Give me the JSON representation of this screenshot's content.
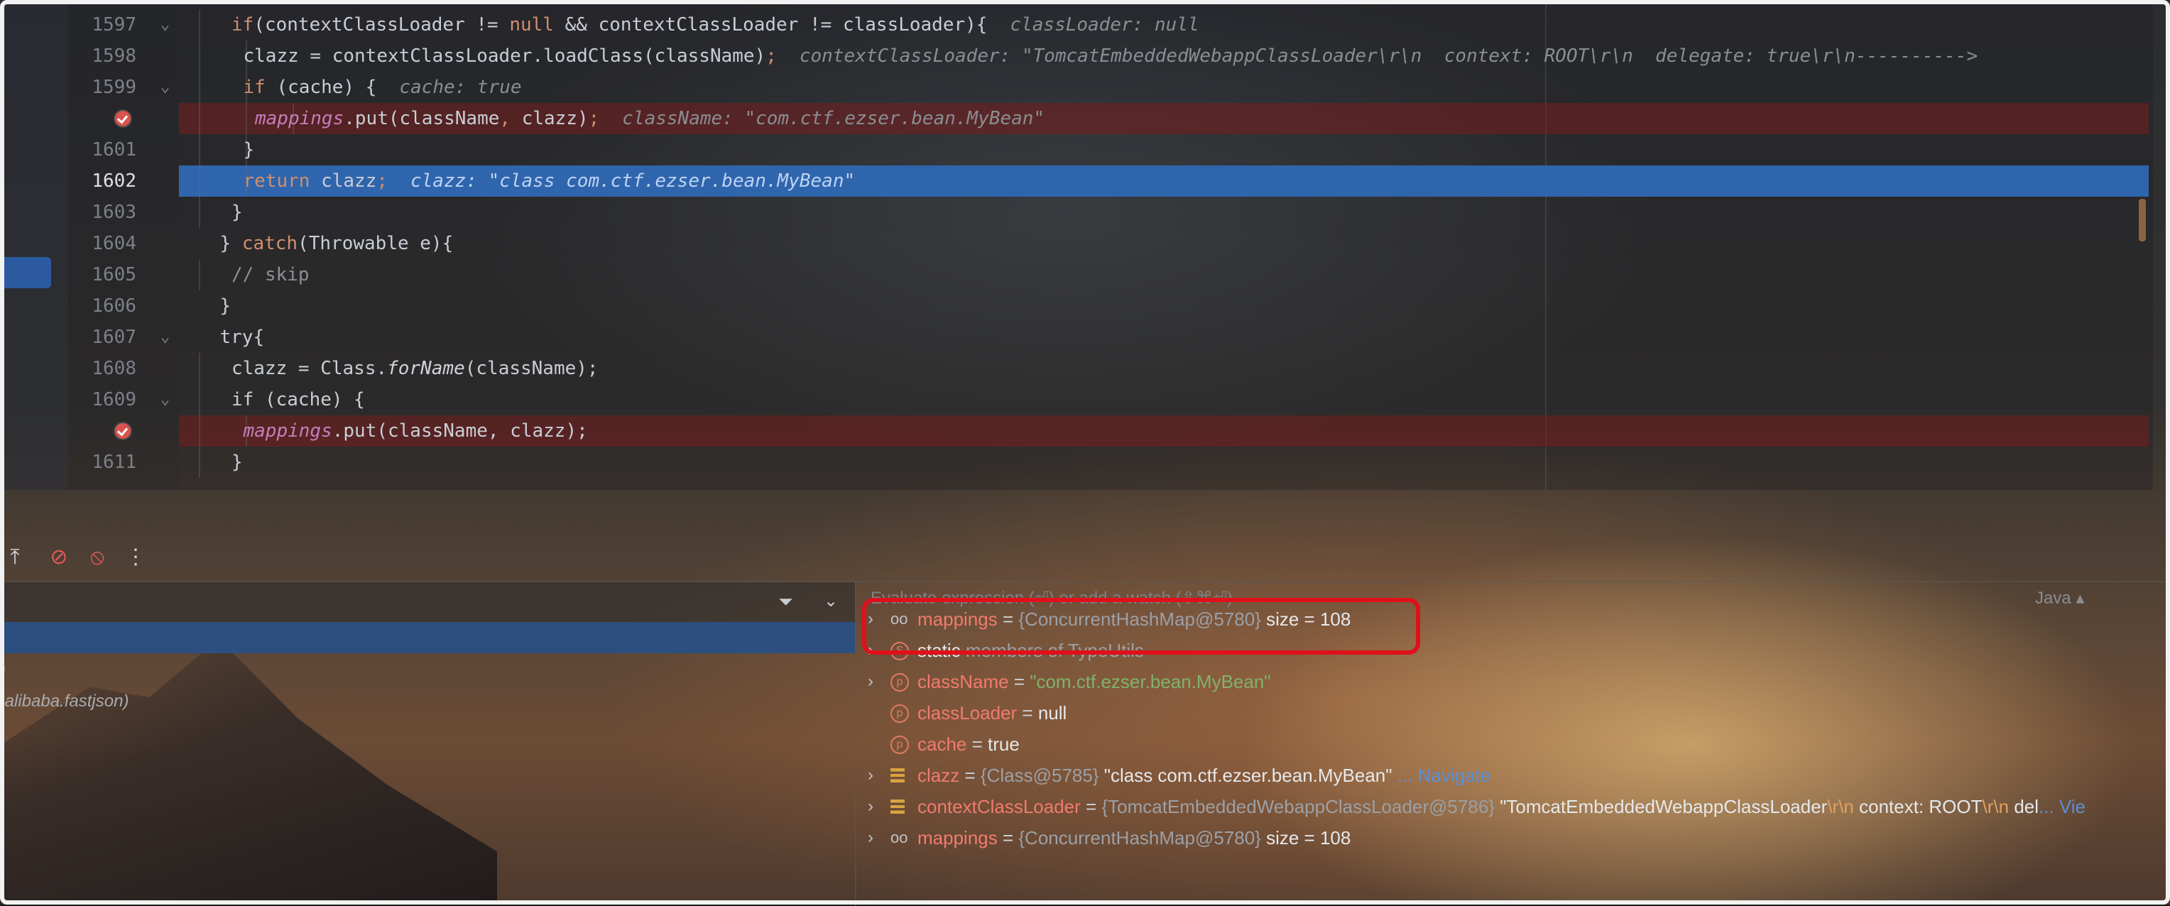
{
  "editor": {
    "lines": [
      {
        "num": "1597",
        "fold": "⌄",
        "code": [
          [
            "kw",
            "if"
          ],
          [
            "t",
            "(contextClassLoader != "
          ],
          [
            "kw",
            "null"
          ],
          [
            "t",
            " && contextClassLoader != classLoader){"
          ]
        ],
        "hint": "classLoader: null",
        "indent": 4
      },
      {
        "num": "1598",
        "code": [
          [
            "t",
            "clazz = contextClassLoader.loadClass(className)"
          ],
          [
            "kw",
            ";"
          ]
        ],
        "hint": "contextClassLoader: \"TomcatEmbeddedWebappClassLoader\\r\\n  context: ROOT\\r\\n  delegate: true\\r\\n---------->",
        "indent": 5
      },
      {
        "num": "1599",
        "fold": "⌄",
        "code": [
          [
            "kw",
            "if"
          ],
          [
            "t",
            " (cache) {"
          ]
        ],
        "hint": "cache: true",
        "indent": 5
      },
      {
        "num": "",
        "bp": true,
        "code": [
          [
            "fld",
            "mappings"
          ],
          [
            "t",
            ".put(className"
          ],
          [
            "kw",
            ","
          ],
          [
            "t",
            " clazz)"
          ],
          [
            "kw",
            ";"
          ]
        ],
        "hint": "className: \"com.ctf.ezser.bean.MyBean\"",
        "indent": 6
      },
      {
        "num": "1601",
        "code": [
          [
            "t",
            "}"
          ]
        ],
        "indent": 5
      },
      {
        "num": "1602",
        "cur": true,
        "code": [
          [
            "kw",
            "return"
          ],
          [
            "t",
            " clazz"
          ],
          [
            "kw",
            ";"
          ]
        ],
        "hint": "clazz: \"class com.ctf.ezser.bean.MyBean\"",
        "indent": 5
      },
      {
        "num": "1603",
        "code": [
          [
            "t",
            "}"
          ]
        ],
        "indent": 4
      },
      {
        "num": "1604",
        "code": [
          [
            "t",
            "} "
          ],
          [
            "kw",
            "catch"
          ],
          [
            "t",
            "(Throwable e){"
          ]
        ],
        "indent": 3
      },
      {
        "num": "1605",
        "code": [
          [
            "cmt",
            "// skip"
          ]
        ],
        "indent": 4
      },
      {
        "num": "1606",
        "code": [
          [
            "t",
            "}"
          ]
        ],
        "indent": 3
      },
      {
        "num": "1607",
        "fold": "⌄",
        "code": [
          [
            "t",
            "try{"
          ]
        ],
        "indent": 3
      },
      {
        "num": "1608",
        "code": [
          [
            "t",
            "clazz = Class."
          ],
          [
            "ital",
            "forName"
          ],
          [
            "t",
            "(className);"
          ]
        ],
        "indent": 4
      },
      {
        "num": "1609",
        "fold": "⌄",
        "code": [
          [
            "t",
            "if (cache) {"
          ]
        ],
        "indent": 4
      },
      {
        "num": "",
        "bp": true,
        "code": [
          [
            "fld",
            "mappings"
          ],
          [
            "t",
            ".put(className, clazz);"
          ]
        ],
        "indent": 5
      },
      {
        "num": "1611",
        "code": [
          [
            "t",
            "}"
          ]
        ],
        "indent": 4
      }
    ]
  },
  "toolbar": {
    "icons": [
      "export-icon",
      "mute-breakpoints-icon",
      "clear-breakpoints-icon",
      "more-icon"
    ],
    "glyphs": [
      "⤒",
      "⊘",
      "⦸",
      "⋮"
    ]
  },
  "frames": {
    "filter_glyph": "⏷",
    "chevron_glyph": "⌄",
    "rows": [
      ")",
      ".alibaba.fastjson)"
    ]
  },
  "variables": {
    "eval_placeholder": "Evaluate expression (⏎) or add a watch (⇧⌘⏎)",
    "lang": "Java ▴",
    "rows": [
      {
        "arrow": "›",
        "icon": "watch",
        "name": "mappings",
        "eq": " = ",
        "type": "{ConcurrentHashMap@5780}",
        "rest": "  size = 108"
      },
      {
        "arrow": "›",
        "icon": "static",
        "static": true,
        "name": "static",
        "rest": " members of TypeUtils"
      },
      {
        "arrow": "›",
        "icon": "param",
        "name": "className",
        "eq": " = ",
        "str": "\"com.ctf.ezser.bean.MyBean\""
      },
      {
        "arrow": "",
        "icon": "param",
        "name": "classLoader",
        "eq": " = ",
        "val": "null"
      },
      {
        "arrow": "",
        "icon": "param",
        "name": "cache",
        "eq": " = ",
        "val": "true"
      },
      {
        "arrow": "›",
        "icon": "field",
        "name": "clazz",
        "eq": " = ",
        "type": "{Class@5785}",
        "val": " \"class com.ctf.ezser.bean.MyBean\"",
        "nav": " ... Navigate"
      },
      {
        "arrow": "›",
        "icon": "field",
        "name": "contextClassLoader",
        "eq": " = ",
        "type": "{TomcatEmbeddedWebappClassLoader@5786}",
        "val": " \"TomcatEmbeddedWebappClassLoader",
        "esc1": "\\r\\n",
        "val2": "  context: ROOT",
        "esc2": "\\r\\n",
        "val3": "  del",
        "nav": "... Vie"
      },
      {
        "arrow": "›",
        "icon": "watch",
        "name": "mappings",
        "eq": " = ",
        "type": "{ConcurrentHashMap@5780}",
        "rest": "  size = 108"
      }
    ]
  },
  "colors": {
    "highlight": "#e0101a",
    "selection": "#2f65ad"
  }
}
